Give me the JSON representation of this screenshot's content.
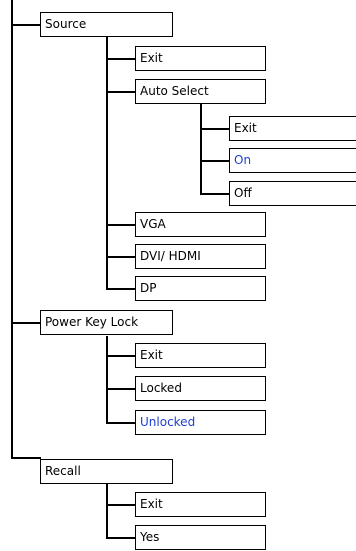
{
  "colors": {
    "line": "#000000",
    "text": "#000000",
    "highlight": "#1f3fd1"
  },
  "menu": [
    {
      "label": "Source",
      "children": [
        {
          "label": "Exit"
        },
        {
          "label": "Auto Select",
          "children": [
            {
              "label": "Exit"
            },
            {
              "label": "On",
              "highlighted": true
            },
            {
              "label": "Off"
            }
          ]
        },
        {
          "label": "VGA"
        },
        {
          "label": "DVI/ HDMI"
        },
        {
          "label": "DP"
        }
      ]
    },
    {
      "label": "Power Key Lock",
      "children": [
        {
          "label": "Exit"
        },
        {
          "label": "Locked"
        },
        {
          "label": "Unlocked",
          "highlighted": true
        }
      ]
    },
    {
      "label": "Recall",
      "children": [
        {
          "label": "Exit"
        },
        {
          "label": "Yes"
        }
      ]
    }
  ]
}
